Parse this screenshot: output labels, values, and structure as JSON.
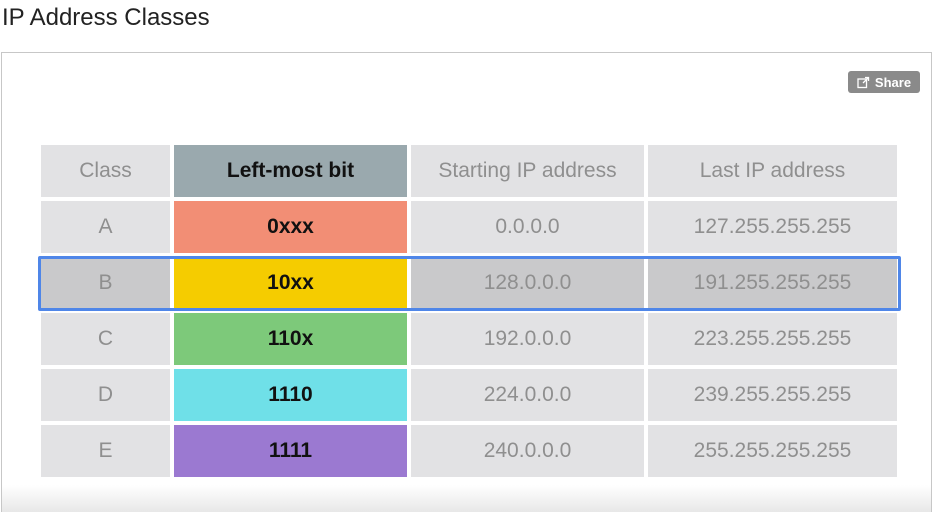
{
  "page": {
    "title": "IP Address Classes"
  },
  "toolbar": {
    "share_label": "Share",
    "share_icon": "external-share-icon"
  },
  "table": {
    "headers": {
      "class": "Class",
      "bit": "Left-most bit",
      "start": "Starting IP address",
      "last": "Last IP address"
    },
    "rows": [
      {
        "class": "A",
        "bit": "0xxx",
        "start": "0.0.0.0",
        "last": "127.255.255.255",
        "color": "#f28e75"
      },
      {
        "class": "B",
        "bit": "10xx",
        "start": "128.0.0.0",
        "last": "191.255.255.255",
        "color": "#f5cc00"
      },
      {
        "class": "C",
        "bit": "110x",
        "start": "192.0.0.0",
        "last": "223.255.255.255",
        "color": "#7dc97a"
      },
      {
        "class": "D",
        "bit": "1110",
        "start": "224.0.0.0",
        "last": "239.255.255.255",
        "color": "#6fe0e8"
      },
      {
        "class": "E",
        "bit": "1111",
        "start": "240.0.0.0",
        "last": "255.255.255.255",
        "color": "#9b79d1"
      }
    ],
    "highlighted_row": "B",
    "highlight_color": "#4f86e8",
    "header_bit_color": "#9aa9ae"
  }
}
